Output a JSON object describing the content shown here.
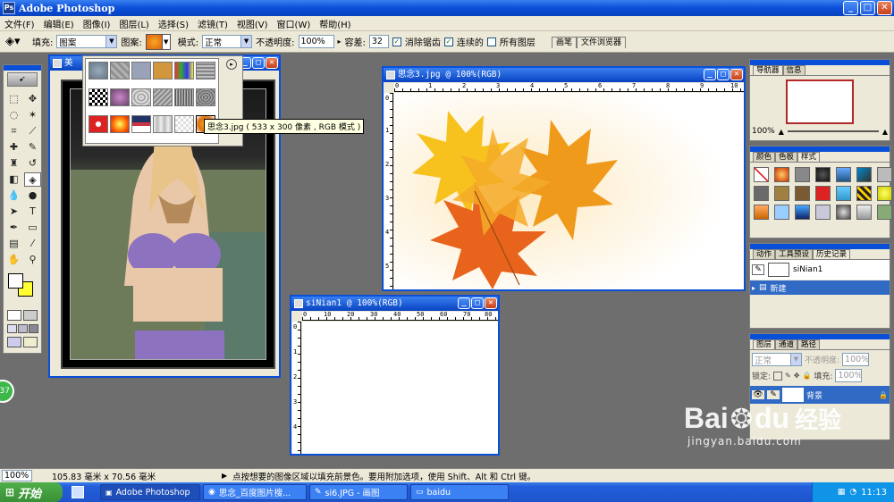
{
  "app": {
    "title": "Adobe Photoshop",
    "icon_label": "Ps"
  },
  "menu": [
    "文件(F)",
    "编辑(E)",
    "图像(I)",
    "图层(L)",
    "选择(S)",
    "滤镜(T)",
    "视图(V)",
    "窗口(W)",
    "帮助(H)"
  ],
  "options": {
    "fill_label": "填充:",
    "fill_value": "图案",
    "pattern_label": "图案:",
    "mode_label": "模式:",
    "mode_value": "正常",
    "opacity_label": "不透明度:",
    "opacity_value": "100%",
    "tolerance_label": "容差:",
    "tolerance_value": "32",
    "antialias_label": "消除锯齿",
    "contiguous_label": "连续的",
    "all_layers_label": "所有图层",
    "panel_tabs": [
      "画笔",
      "文件浏览器"
    ]
  },
  "pattern_tooltip": "思念3.jpg ( 533 x 300 像素 , RGB 模式 )",
  "documents": {
    "doc1_title": "思念3.jpg @ 100%(RGB)",
    "doc2_title": "siNian1 @ 100%(RGB)",
    "doc0_title": "美"
  },
  "ruler_numbers_doc1": [
    "0",
    "1",
    "2",
    "3",
    "4",
    "5",
    "6",
    "7",
    "8",
    "9",
    "10"
  ],
  "ruler_numbers_doc2": [
    "0",
    "10",
    "20",
    "30",
    "40",
    "50",
    "60",
    "70",
    "80"
  ],
  "ruler_v_doc1": [
    "0",
    "1",
    "2",
    "3",
    "4",
    "5",
    "6"
  ],
  "ruler_v_doc2": [
    "0",
    "1",
    "2",
    "3",
    "4"
  ],
  "panels": {
    "navigator_tabs": [
      "导航器",
      "信息"
    ],
    "navigator_zoom": "100%",
    "styles_tabs": [
      "颜色",
      "色板",
      "样式"
    ],
    "history_tabs": [
      "动作",
      "工具预设",
      "历史记录"
    ],
    "history_snapshot": "siNian1",
    "history_state": "新建",
    "layers_tabs": [
      "图层",
      "通道",
      "路径"
    ],
    "layers_mode": "正常",
    "layers_opacity_label": "不透明度:",
    "layers_opacity": "100%",
    "layers_lock_label": "锁定:",
    "layers_fill_label": "填充:",
    "layers_fill": "100%",
    "layer_name": "背景"
  },
  "status": {
    "zoom": "100%",
    "dimensions": "105.83 毫米 x 70.56 毫米",
    "hint": "点按想要的图像区域以填充前景色。要用附加选项，使用 Shift、Alt 和 Ctrl 键。"
  },
  "taskbar": {
    "start": "开始",
    "tasks": [
      "Adobe Photoshop",
      "思念_百度图片搜...",
      "si6.JPG - 画图",
      "baidu"
    ],
    "clock": "11:13"
  },
  "side_badge": "37",
  "watermark": {
    "brand": "Bai",
    "brand2": "du",
    "cn": "经验",
    "url": "jingyan.baidu.com"
  }
}
